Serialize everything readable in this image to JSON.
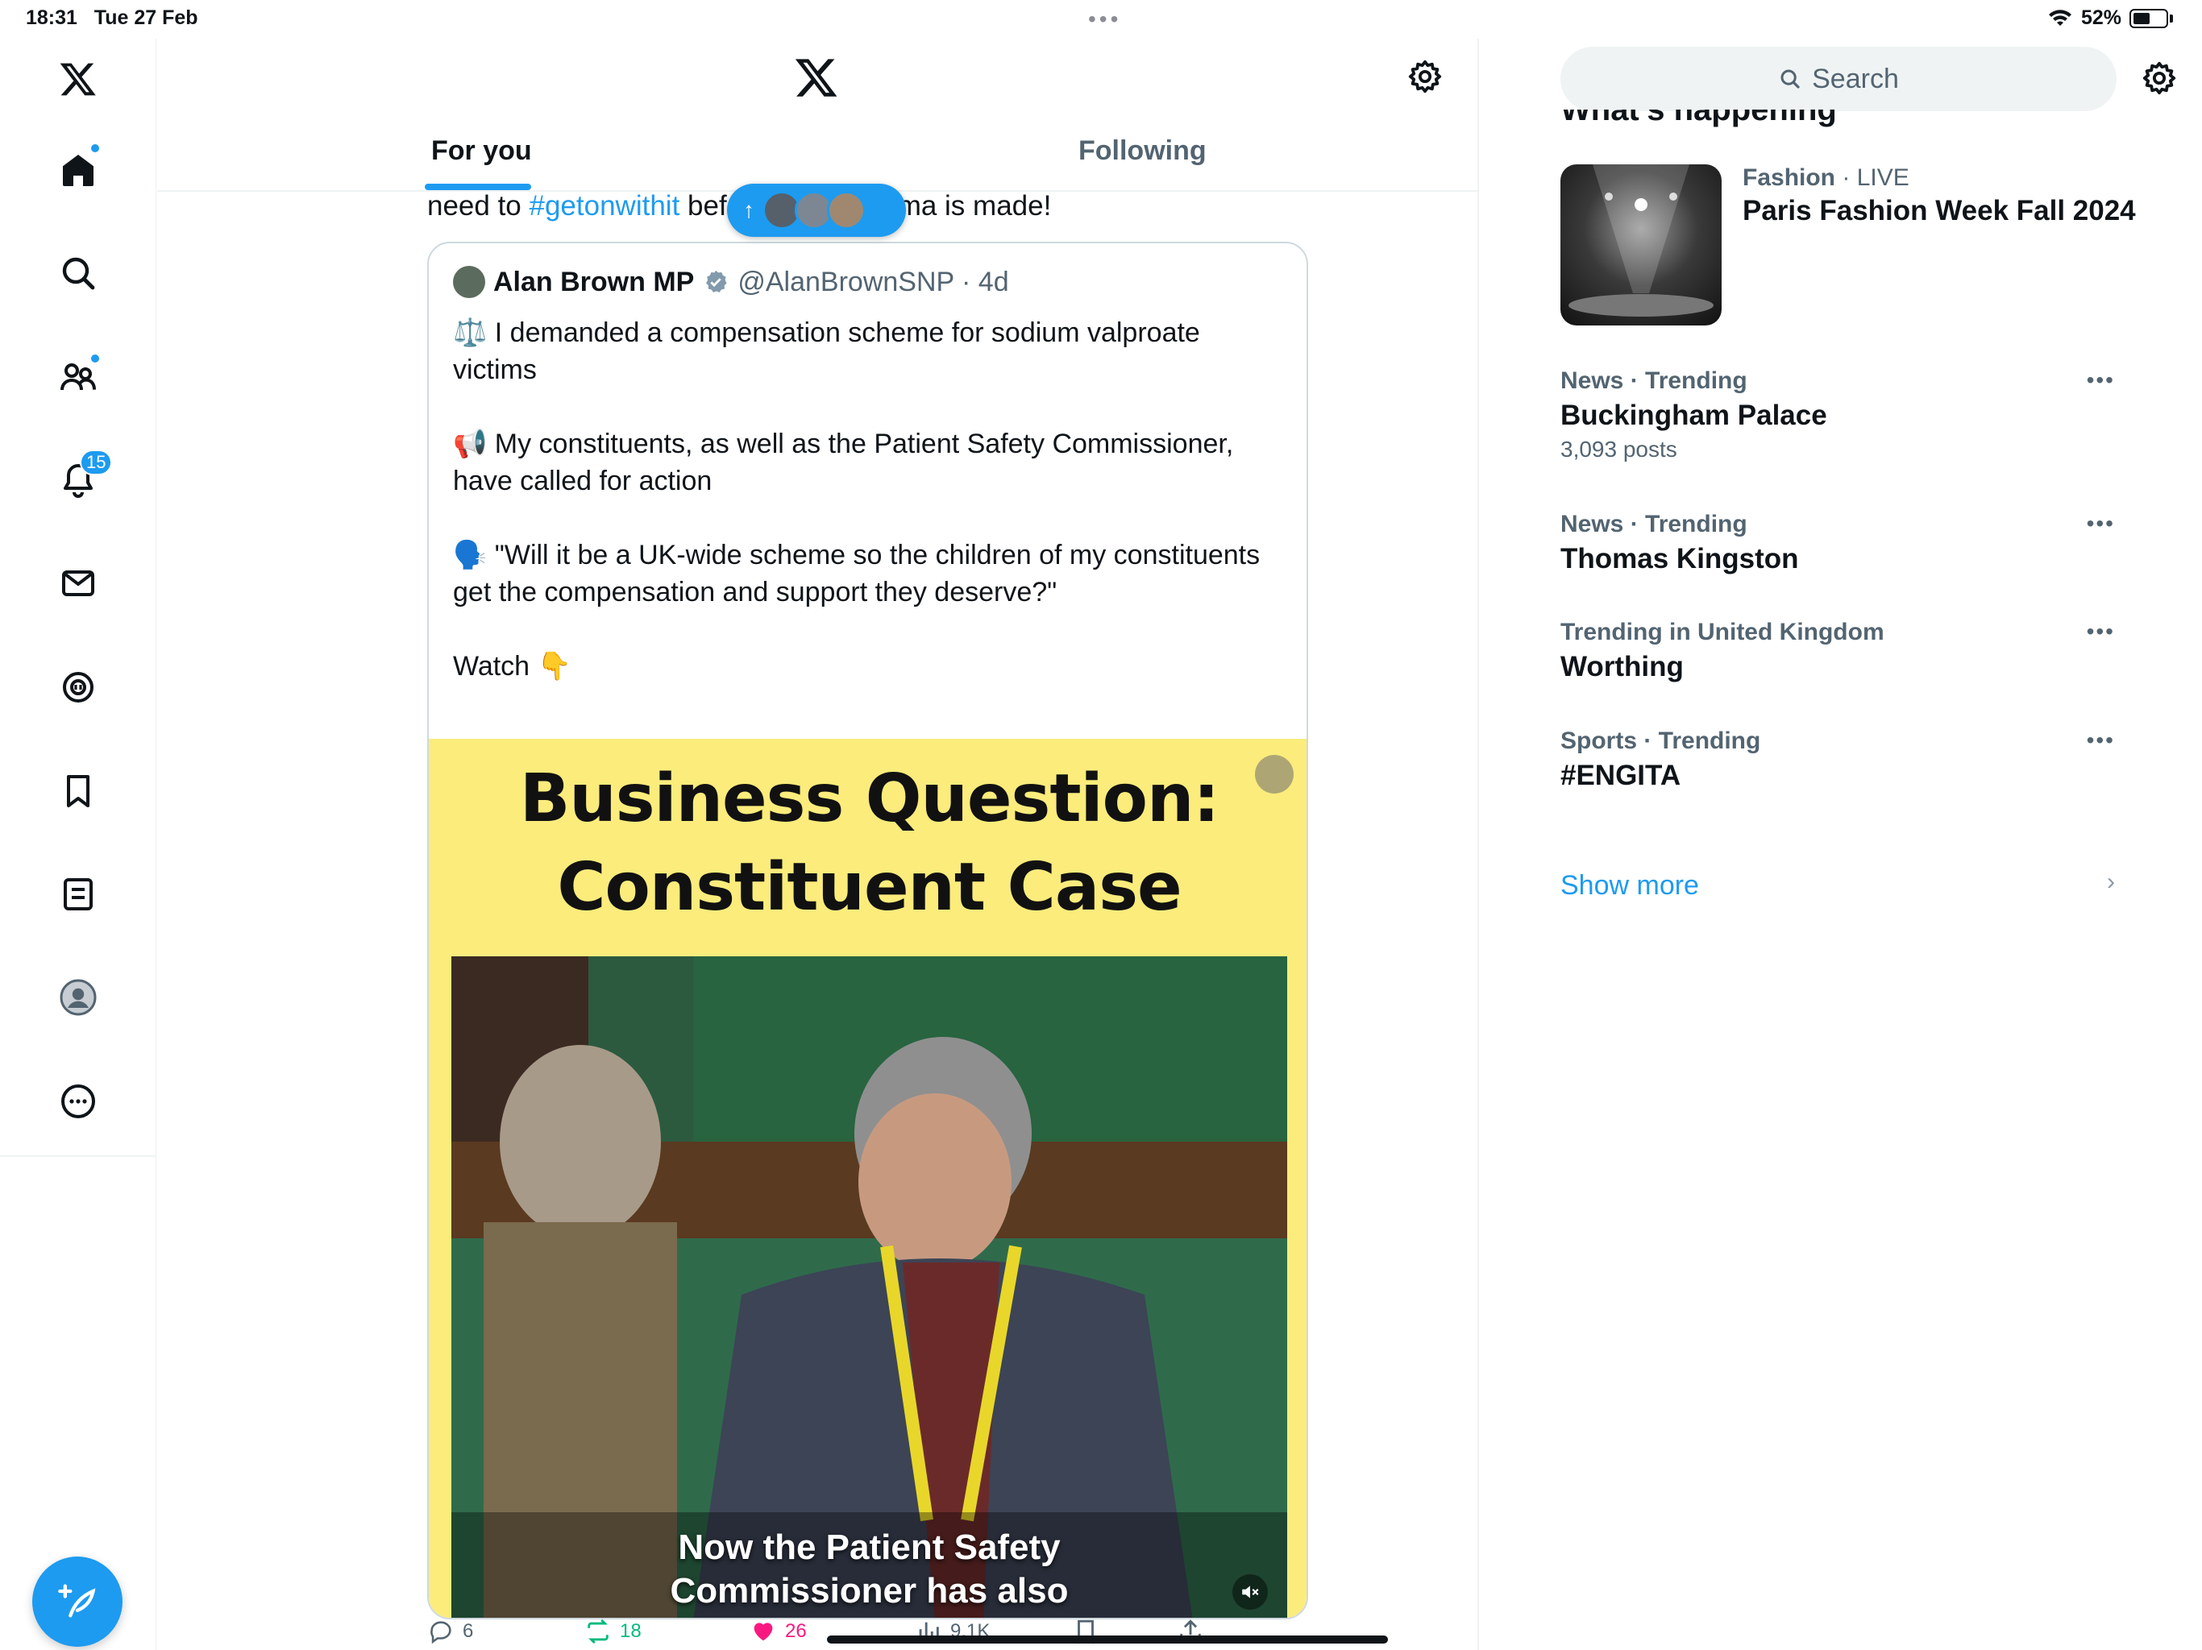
{
  "status_bar": {
    "time": "18:31",
    "date": "Tue 27 Feb",
    "battery": "52%",
    "battery_level": 0.52
  },
  "sidebar": {
    "items": [
      {
        "name": "home",
        "has_dot": true
      },
      {
        "name": "explore"
      },
      {
        "name": "communities",
        "has_dot": true
      },
      {
        "name": "notifications",
        "badge": "15"
      },
      {
        "name": "messages"
      },
      {
        "name": "grok"
      },
      {
        "name": "bookmarks"
      },
      {
        "name": "lists"
      },
      {
        "name": "profile"
      },
      {
        "name": "more"
      }
    ]
  },
  "header": {
    "tabs": [
      {
        "label": "For you",
        "active": true
      },
      {
        "label": "Following",
        "active": false
      }
    ]
  },
  "feed": {
    "top_text_before": "need to ",
    "top_hashtag": "#getonwithit",
    "top_text_partial_left": " bef",
    "top_text_partial_right": "ma is made!",
    "quote": {
      "name": "Alan Brown MP",
      "handle": "@AlanBrownSNP",
      "age": "4d",
      "paragraphs": [
        "⚖️ I demanded a compensation scheme for sodium valproate victims",
        "📢 My constituents, as well as the Patient Safety Commissioner, have called for action",
        "🗣️ \"Will it be a UK-wide scheme so the children of my constituents get the compensation and support they deserve?\"",
        "Watch 👇"
      ],
      "media_title_line1": "Business Question:",
      "media_title_line2": "Constituent Case",
      "video_caption_line1": "Now the Patient Safety",
      "video_caption_line2": "Commissioner has also"
    },
    "actions": {
      "replies": "6",
      "reposts": "18",
      "likes": "26",
      "views": "9.1K"
    },
    "colors": {
      "repost": "#00ba7c",
      "like": "#f91880",
      "accent": "#1d9bf0"
    }
  },
  "right": {
    "search_placeholder": "Search",
    "section_title": "What's happening",
    "live_trend": {
      "category": "Fashion",
      "live_label": "LIVE",
      "title": "Paris Fashion Week Fall 2024"
    },
    "trends": [
      {
        "category": "News · Trending",
        "title": "Buckingham Palace",
        "posts": "3,093 posts"
      },
      {
        "category": "News · Trending",
        "title": "Thomas Kingston"
      },
      {
        "category": "Trending in United Kingdom",
        "title": "Worthing"
      },
      {
        "category": "Sports · Trending",
        "title": "#ENGITA"
      }
    ],
    "show_more": "Show more"
  }
}
